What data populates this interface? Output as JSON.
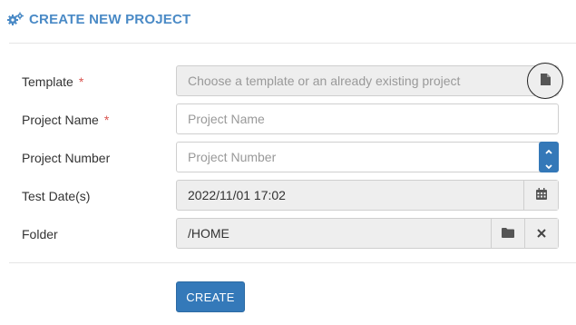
{
  "header": {
    "icon": "cogs-icon",
    "title": "CREATE NEW PROJECT",
    "color": "#4a8ac6"
  },
  "form": {
    "template": {
      "label": "Template",
      "required_mark": "*",
      "placeholder": "Choose a template or an already existing project",
      "button_icon": "file-icon"
    },
    "project_name": {
      "label": "Project Name",
      "required_mark": "*",
      "placeholder": "Project Name"
    },
    "project_number": {
      "label": "Project Number",
      "placeholder": "Project Number",
      "spinner_up_icon": "chevron-up-icon",
      "spinner_down_icon": "chevron-down-icon"
    },
    "test_dates": {
      "label": "Test Date(s)",
      "value": "2022/11/01 17:02",
      "button_icon": "calendar-icon"
    },
    "folder": {
      "label": "Folder",
      "value": "/HOME",
      "browse_icon": "folder-icon",
      "clear_icon": "close-icon"
    }
  },
  "actions": {
    "create_label": "CREATE",
    "create_color": "#3479b9"
  }
}
